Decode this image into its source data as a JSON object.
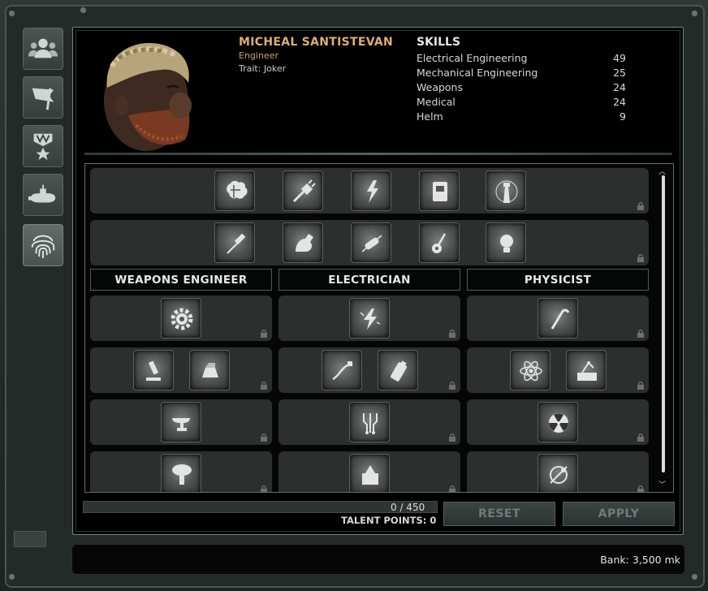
{
  "tabs": [
    {
      "icon": "crew-icon"
    },
    {
      "icon": "flag-icon"
    },
    {
      "icon": "rank-icon"
    },
    {
      "icon": "submarine-icon"
    },
    {
      "icon": "fingerprint-icon",
      "active": true
    }
  ],
  "character": {
    "name": "MICHEAL SANTISTEVAN",
    "job": "Engineer",
    "trait": "Trait: Joker"
  },
  "skills": {
    "title": "SKILLS",
    "items": [
      {
        "label": "Electrical Engineering",
        "value": "49"
      },
      {
        "label": "Mechanical Engineering",
        "value": "25"
      },
      {
        "label": "Weapons",
        "value": "24"
      },
      {
        "label": "Medical",
        "value": "24"
      },
      {
        "label": "Helm",
        "value": "9"
      }
    ]
  },
  "talents": {
    "common_rows": [
      [
        "brain-icon",
        "wire-plug-icon",
        "lightning-storm-icon",
        "manual-icon",
        "lighthouse-icon"
      ],
      [
        "screwdriver-icon",
        "muscle-arm-icon",
        "fuse-icon",
        "guitar-icon",
        "lightbulb-icon"
      ]
    ],
    "subclasses": [
      {
        "title": "WEAPONS ENGINEER",
        "rows": [
          [
            "gear-icon"
          ],
          [
            "microscope-icon",
            "ingot-icon"
          ],
          [
            "anvil-icon"
          ],
          [
            "mushroom-cloud-icon"
          ]
        ]
      },
      {
        "title": "ELECTRICIAN",
        "rows": [
          [
            "shock-icon"
          ],
          [
            "cable-icon",
            "battery-icon"
          ],
          [
            "circuit-icon"
          ],
          [
            "generator-icon"
          ]
        ]
      },
      {
        "title": "PHYSICIST",
        "rows": [
          [
            "crowbar-icon"
          ],
          [
            "atom-icon",
            "reactor-schematic-icon"
          ],
          [
            "radiation-icon"
          ],
          [
            "orbit-tool-icon"
          ]
        ]
      }
    ]
  },
  "progress": {
    "text": "0 / 450",
    "fraction": 0
  },
  "talent_points": "TALENT POINTS: 0",
  "buttons": {
    "reset": "RESET",
    "apply": "APPLY"
  },
  "bank": "Bank: 3,500 mk",
  "colors": {
    "accent": "#e0ae72",
    "panel_border": "#6f8a84"
  }
}
